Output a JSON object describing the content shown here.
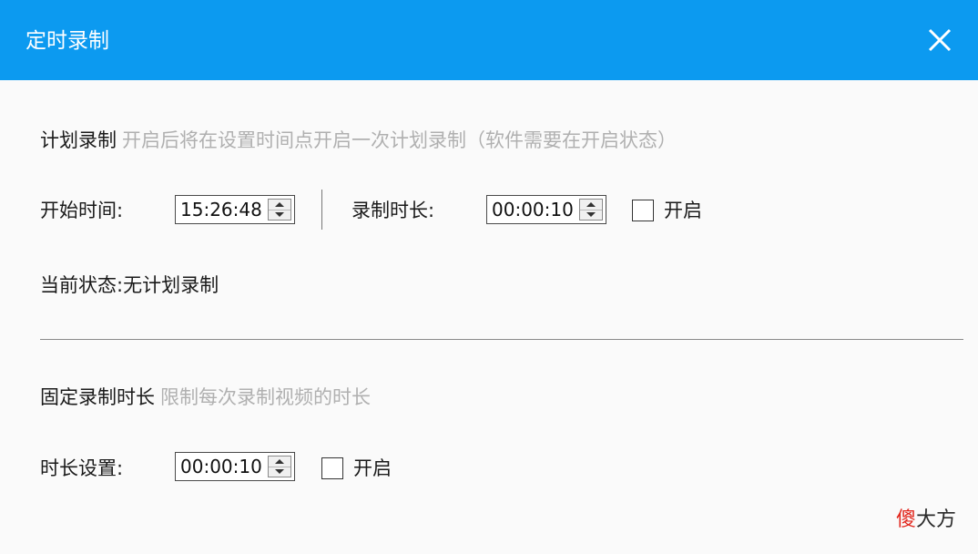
{
  "window": {
    "title": "定时录制"
  },
  "scheduled": {
    "title": "计划录制",
    "hint": "开启后将在设置时间点开启一次计划录制（软件需要在开启状态）",
    "start_time_label": "开始时间:",
    "start_time_value": "15:26:48",
    "duration_label": "录制时长:",
    "duration_value": "00:00:10",
    "enable_label": "开启",
    "status_label": "当前状态:",
    "status_value": "无计划录制"
  },
  "fixed": {
    "title": "固定录制时长",
    "hint": "限制每次录制视频的时长",
    "duration_label": "时长设置:",
    "duration_value": "00:00:10",
    "enable_label": "开启"
  },
  "watermark": {
    "red_part": "傻",
    "rest": "大方"
  },
  "colors": {
    "titlebar": "#0c9af0",
    "hint_text": "#b0b0b0",
    "watermark_red": "#e2261c"
  }
}
